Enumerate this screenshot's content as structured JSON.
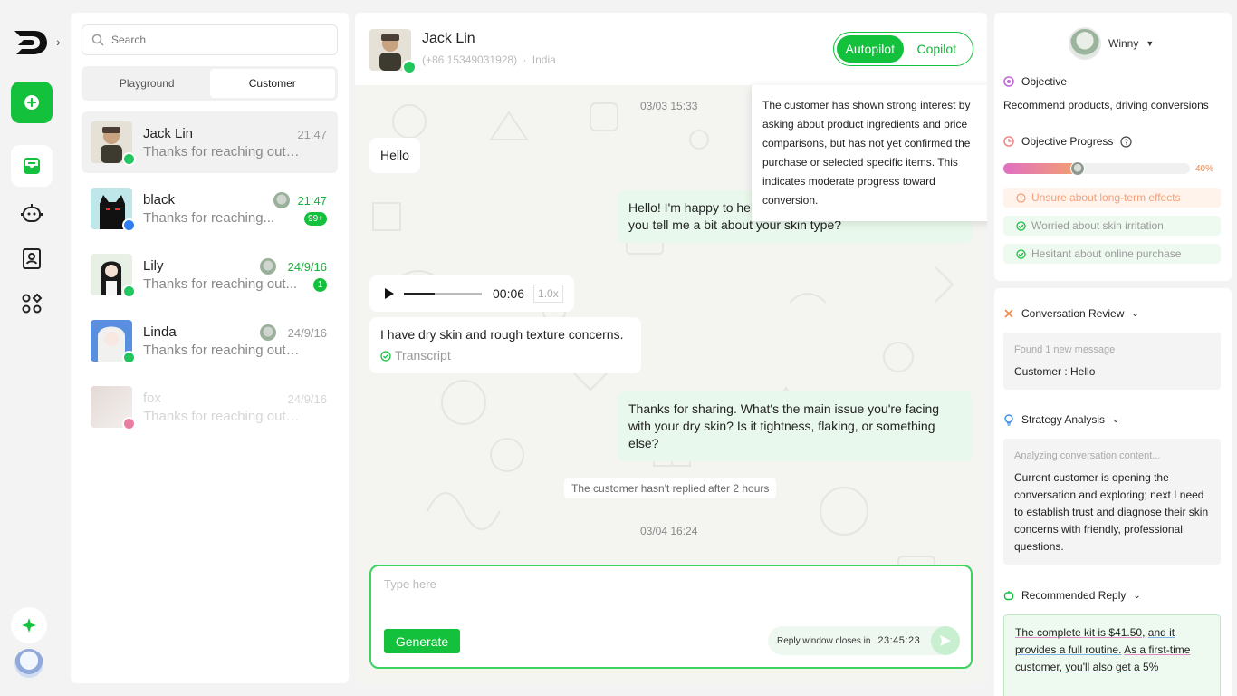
{
  "search": {
    "placeholder": "Search"
  },
  "tabs": {
    "playground": "Playground",
    "customer": "Customer"
  },
  "conversations": [
    {
      "name": "Jack Lin",
      "time": "21:47",
      "preview": "Thanks for reaching out to..",
      "channel": "whatsapp",
      "unread": ""
    },
    {
      "name": "black",
      "time": "21:47",
      "preview": "Thanks for reaching...",
      "channel": "messenger",
      "unread": "99+"
    },
    {
      "name": "Lily",
      "time": "24/9/16",
      "preview": "Thanks for reaching out...",
      "channel": "whatsapp",
      "unread": "1"
    },
    {
      "name": "Linda",
      "time": "24/9/16",
      "preview": "Thanks for reaching out to..",
      "channel": "whatsapp",
      "unread": ""
    },
    {
      "name": "fox",
      "time": "24/9/16",
      "preview": "Thanks for reaching out to..",
      "channel": "instagram",
      "unread": ""
    }
  ],
  "chat": {
    "contact_name": "Jack Lin",
    "contact_phone": "(+86 15349031928)",
    "contact_country": "India",
    "mode_autopilot": "Autopilot",
    "mode_copilot": "Copilot",
    "timestamp_1": "03/03 15:33",
    "timestamp_2": "03/04 16:24",
    "msg_hello": "Hello",
    "msg_agent_1": "Hello! I'm happy to help. To give you the best advice, could you tell me a bit about your skin type?",
    "voice_duration": "00:06",
    "voice_speed": "1.0x",
    "voice_progress": 0.4,
    "msg_customer_2": "I have dry skin and rough texture concerns.",
    "transcript_label": "Transcript",
    "msg_agent_2": "Thanks for sharing. What's the main issue you're facing with your dry skin? Is it tightness, flaking, or something else?",
    "notice": "The customer hasn't replied after 2 hours",
    "tooltip": "The customer has shown strong interest by asking about product ingredients and price comparisons, but has not yet confirmed the purchase or selected specific items. This indicates moderate progress toward conversion.",
    "composer_placeholder": "Type here",
    "generate_label": "Generate",
    "reply_window_label": "Reply window closes in",
    "reply_window_countdown": "23:45:23"
  },
  "side": {
    "agent_name": "Winny",
    "objective_title": "Objective",
    "objective_text": "Recommend products, driving conversions",
    "progress_title": "Objective Progress",
    "progress_value": "40%",
    "progress_fraction": 0.4,
    "chips": [
      {
        "label": "Unsure about long-term effects",
        "state": "warn"
      },
      {
        "label": "Worried about skin irritation",
        "state": "ok"
      },
      {
        "label": "Hesitant about online purchase",
        "state": "ok"
      }
    ],
    "review_title": "Conversation Review",
    "review_muted": "Found 1 new message",
    "review_text": "Customer : Hello",
    "strategy_title": "Strategy Analysis",
    "strategy_muted": "Analyzing conversation content...",
    "strategy_text": "Current customer is opening the conversation and exploring; next I need to establish trust and diagnose their skin concerns with friendly, professional questions.",
    "reco_title": "Recommended Reply",
    "reco_part1": "The complete kit is $41.50,",
    "reco_part2": "and it provides a full routine.",
    "reco_part3": "As a first-time customer, you'll also get a 5%"
  },
  "colors": {
    "brand_green": "#13c13c",
    "accent_orange": "#f08a4b"
  }
}
